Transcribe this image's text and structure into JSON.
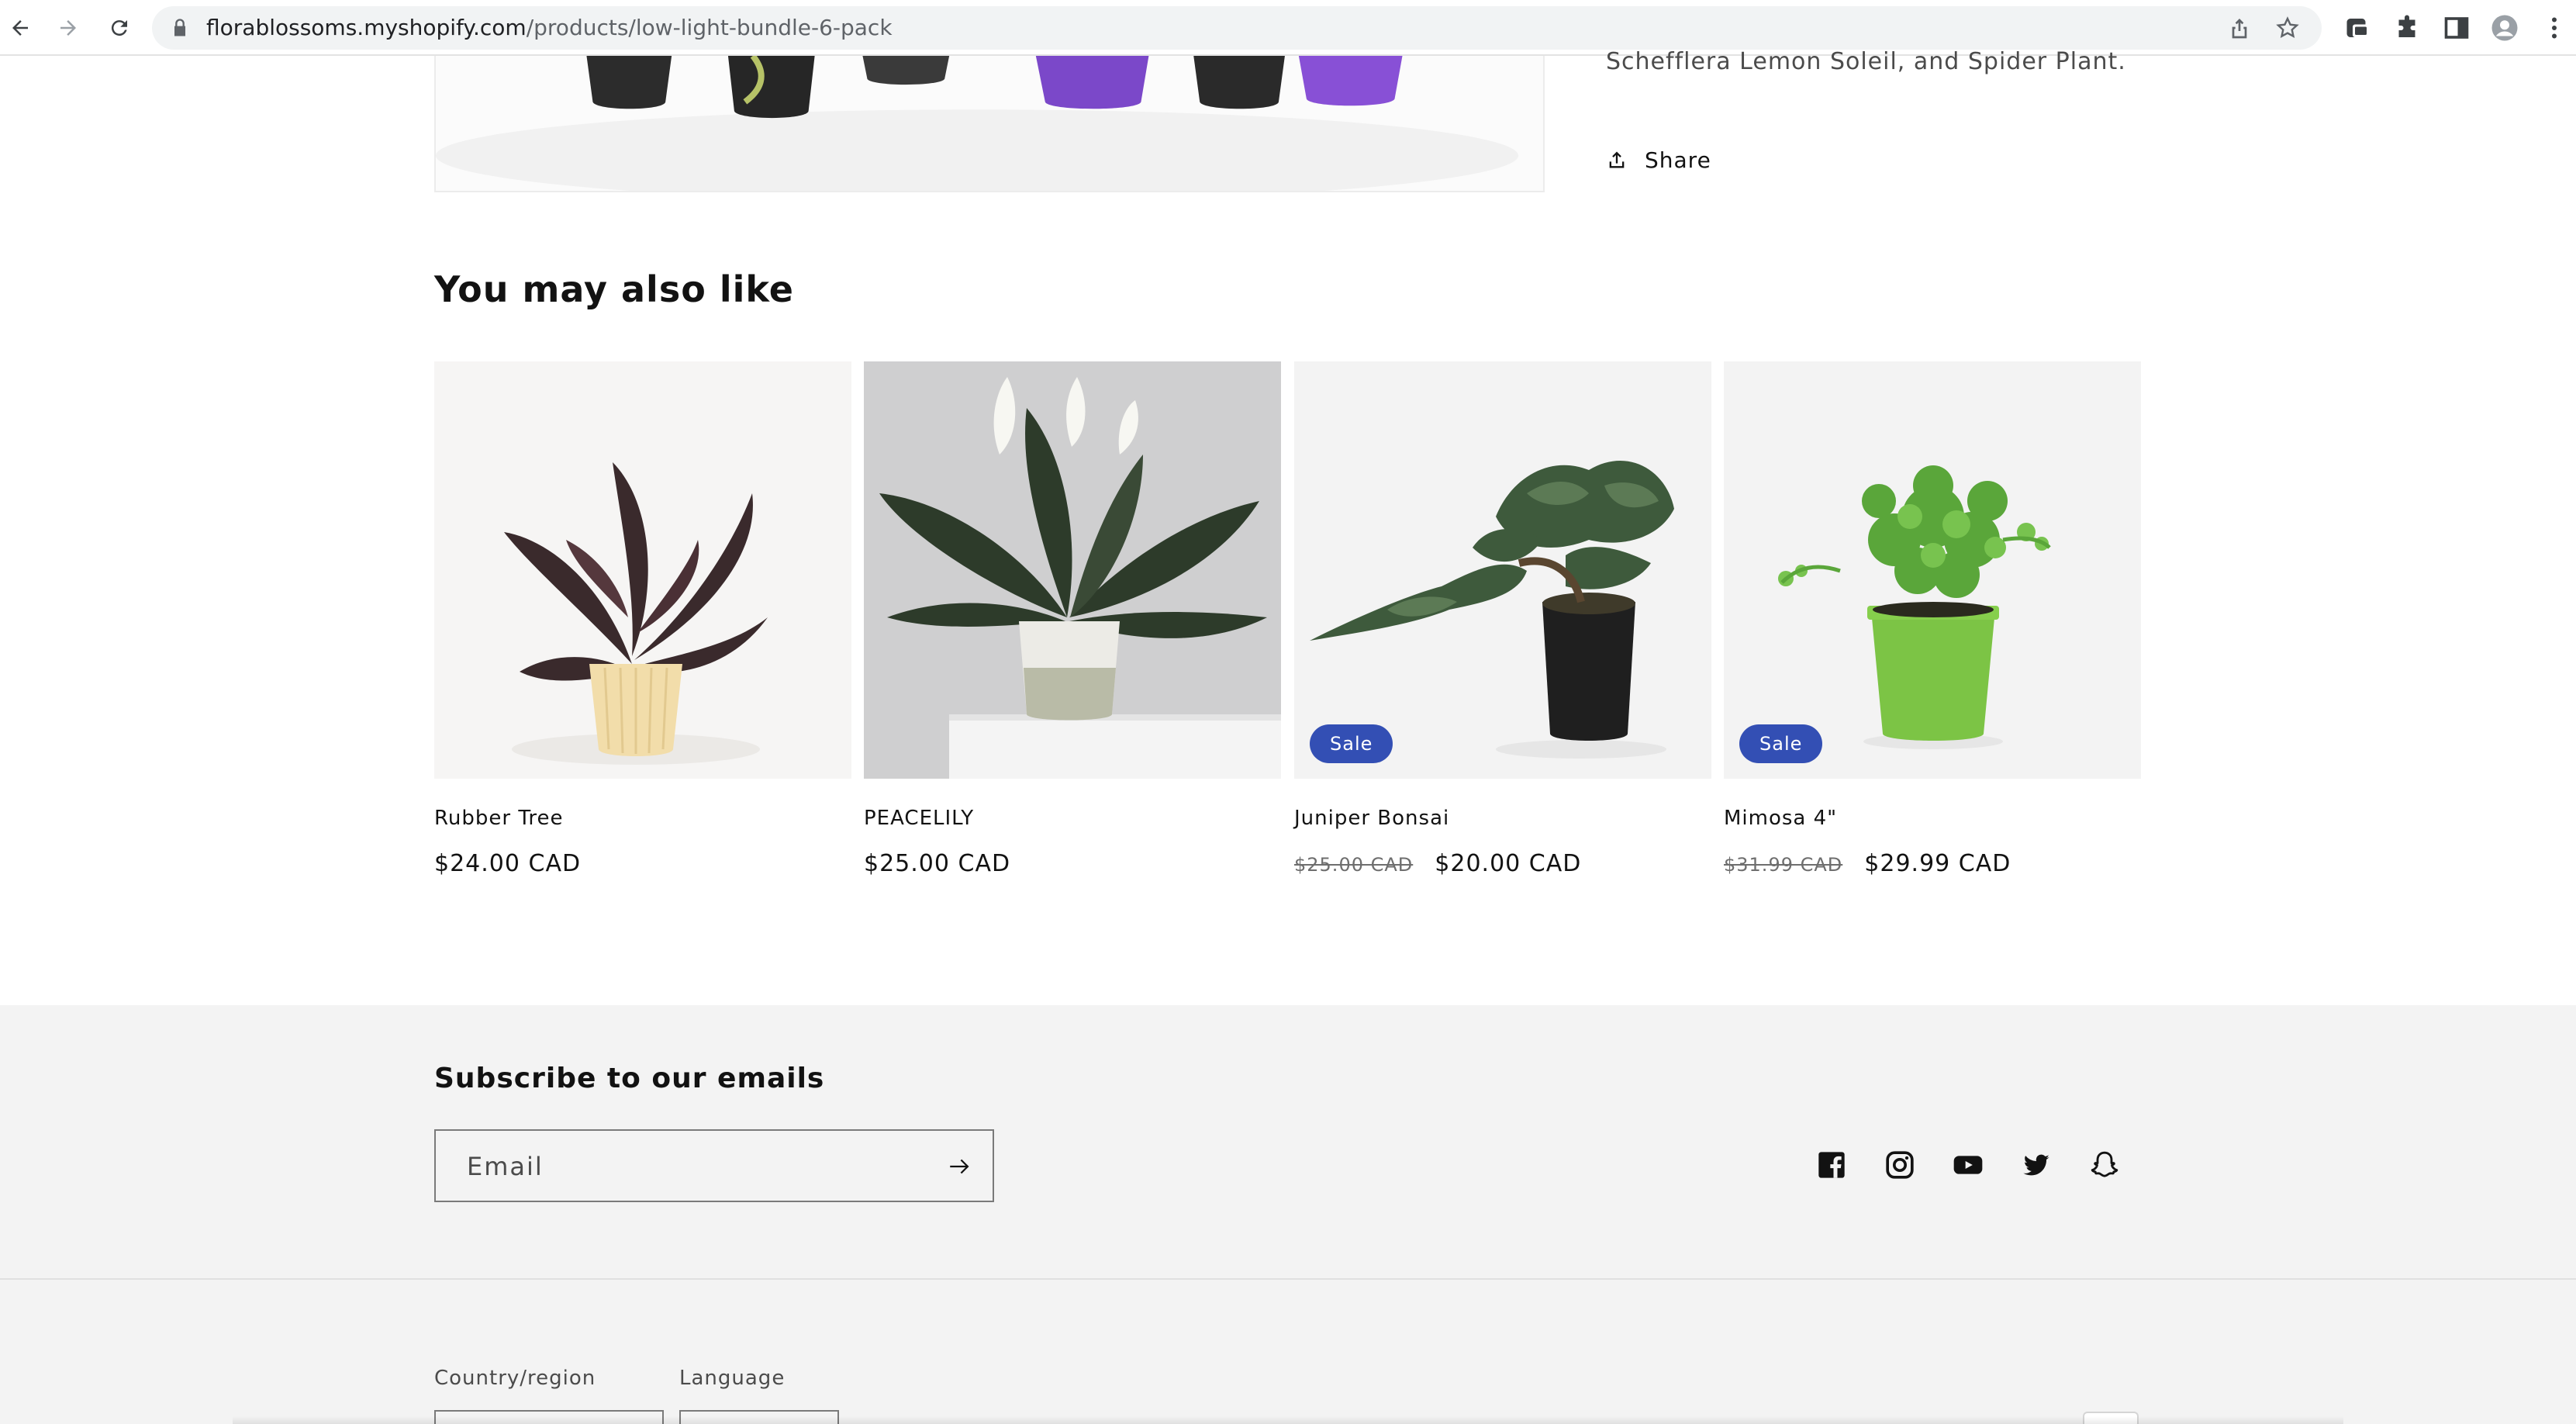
{
  "browser": {
    "url_host": "florablossoms.myshopify.com",
    "url_path": "/products/low-light-bundle-6-pack"
  },
  "product": {
    "description_tail": "Schefflera Lemon Soleil, and Spider Plant.",
    "share_label": "Share"
  },
  "recommendations": {
    "title": "You may also like",
    "items": [
      {
        "name": "Rubber Tree",
        "price": "$24.00 CAD",
        "compare_price": "",
        "badge": ""
      },
      {
        "name": "PEACELILY",
        "price": "$25.00 CAD",
        "compare_price": "",
        "badge": ""
      },
      {
        "name": "Juniper Bonsai",
        "price": "$20.00 CAD",
        "compare_price": "$25.00 CAD",
        "badge": "Sale"
      },
      {
        "name": "Mimosa 4\"",
        "price": "$29.99 CAD",
        "compare_price": "$31.99 CAD",
        "badge": "Sale"
      }
    ]
  },
  "footer": {
    "newsletter_title": "Subscribe to our emails",
    "email_placeholder": "Email",
    "social": [
      "facebook-icon",
      "instagram-icon",
      "youtube-icon",
      "twitter-icon",
      "snapchat-icon"
    ],
    "country_label": "Country/region",
    "language_label": "Language"
  },
  "colors": {
    "sale_badge": "#334fb4",
    "footer_bg": "#f3f3f3",
    "text": "#121212"
  }
}
